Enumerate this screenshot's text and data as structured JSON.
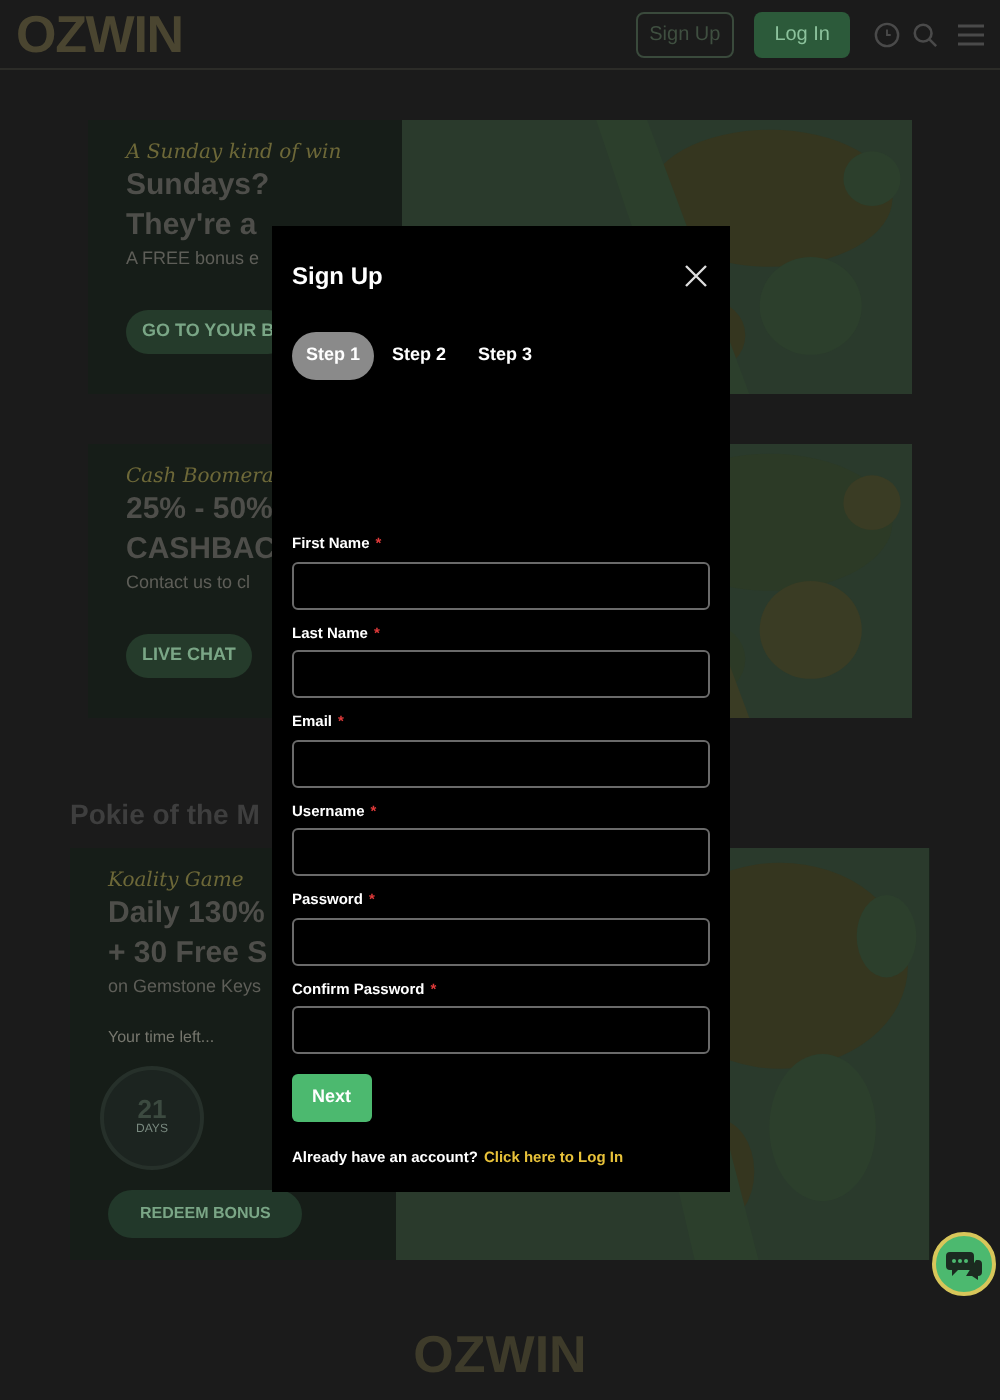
{
  "header": {
    "logo": "OZWIN",
    "buttons": [
      {
        "label": "Sign Up",
        "kind": "outline"
      },
      {
        "label": "Log In",
        "kind": "filled"
      }
    ]
  },
  "banners": [
    {
      "script": "A Sunday kind of win",
      "headline": [
        "Sundays?",
        "They're a"
      ],
      "sub": "A FREE bonus e",
      "button": "GO TO YOUR B"
    },
    {
      "script": "Cash Boomera",
      "headline": [
        "25% - 50%",
        "CASHBAC"
      ],
      "sub": "Contact us to cl",
      "button": "LIVE CHAT"
    }
  ],
  "section_title": "Pokie of the M",
  "feature": {
    "script": "Koality Game",
    "headline": [
      "Daily 130%",
      "+ 30 Free S"
    ],
    "sub": "on Gemstone Keys",
    "timer_label": "Your time left...",
    "countdown": [
      {
        "value": "21",
        "unit": "DAYS"
      }
    ],
    "button": "REDEEM BONUS"
  },
  "footer": {
    "logo": "OZWIN"
  },
  "modal": {
    "title": "Sign Up",
    "steps": [
      {
        "label": "Step 1",
        "selected": true
      },
      {
        "label": "Step 2",
        "selected": false
      },
      {
        "label": "Step 3",
        "selected": false
      }
    ],
    "fields": [
      {
        "label": "First Name",
        "required_mark": "*"
      },
      {
        "label": "Last Name",
        "required_mark": "*"
      },
      {
        "label": "Email",
        "required_mark": "*"
      },
      {
        "label": "Username",
        "required_mark": "*"
      },
      {
        "label": "Password",
        "required_mark": "*"
      },
      {
        "label": "Confirm Password",
        "required_mark": "*"
      }
    ],
    "next_button": "Next",
    "login_prompt": "Already have an account?",
    "login_link": "Click here to Log In"
  }
}
